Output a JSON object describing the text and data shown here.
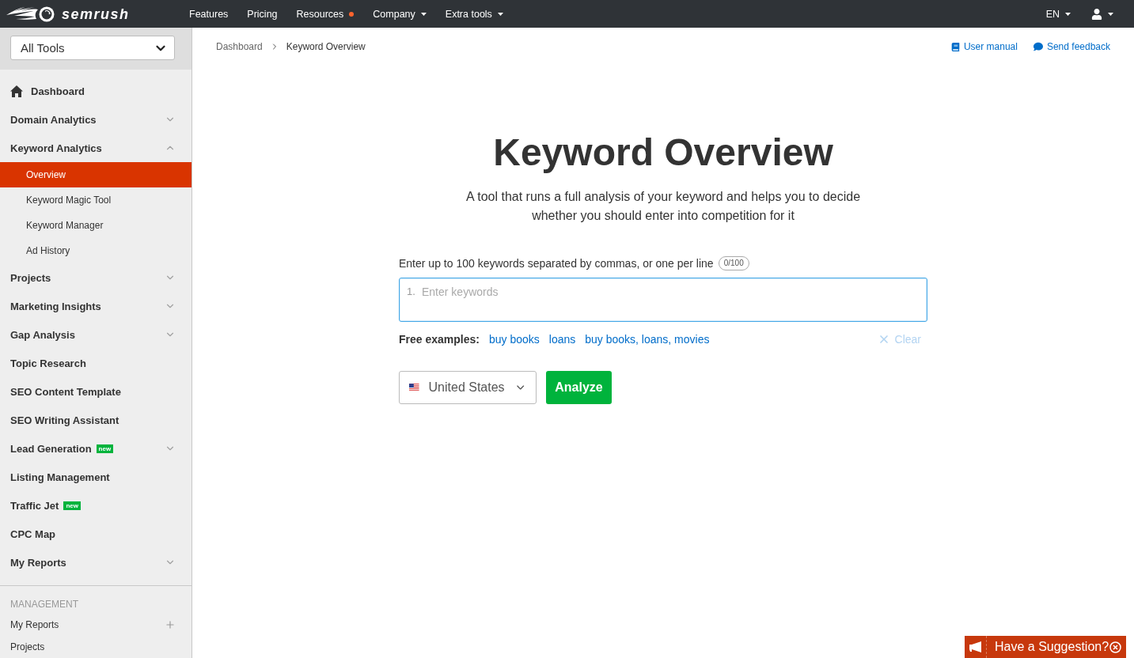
{
  "topbar": {
    "logo": "semrush",
    "nav": [
      {
        "label": "Features",
        "dot": false,
        "caret": false
      },
      {
        "label": "Pricing",
        "dot": false,
        "caret": false
      },
      {
        "label": "Resources",
        "dot": true,
        "caret": false
      },
      {
        "label": "Company",
        "dot": false,
        "caret": true
      },
      {
        "label": "Extra tools",
        "dot": false,
        "caret": true
      }
    ],
    "language": "EN"
  },
  "sidebar": {
    "tool_select": "All Tools",
    "items": [
      {
        "label": "Dashboard",
        "kind": "home"
      },
      {
        "label": "Domain Analytics",
        "kind": "group",
        "expanded": false
      },
      {
        "label": "Keyword Analytics",
        "kind": "group",
        "expanded": true,
        "children": [
          {
            "label": "Overview",
            "selected": true
          },
          {
            "label": "Keyword Magic Tool",
            "selected": false
          },
          {
            "label": "Keyword Manager",
            "selected": false
          },
          {
            "label": "Ad History",
            "selected": false
          }
        ]
      },
      {
        "label": "Projects",
        "kind": "group",
        "expanded": false
      },
      {
        "label": "Marketing Insights",
        "kind": "group",
        "expanded": false
      },
      {
        "label": "Gap Analysis",
        "kind": "group",
        "expanded": false
      },
      {
        "label": "Topic Research",
        "kind": "link"
      },
      {
        "label": "SEO Content Template",
        "kind": "link"
      },
      {
        "label": "SEO Writing Assistant",
        "kind": "link"
      },
      {
        "label": "Lead Generation",
        "kind": "group",
        "expanded": false,
        "badge": "new"
      },
      {
        "label": "Listing Management",
        "kind": "link"
      },
      {
        "label": "Traffic Jet",
        "kind": "link",
        "badge": "new"
      },
      {
        "label": "CPC Map",
        "kind": "link"
      },
      {
        "label": "My Reports",
        "kind": "group",
        "expanded": false
      }
    ],
    "management": {
      "heading": "MANAGEMENT",
      "items": [
        {
          "label": "My Reports",
          "kind": "add"
        },
        {
          "label": "Projects",
          "kind": "plain"
        }
      ]
    }
  },
  "main": {
    "breadcrumb": [
      "Dashboard",
      "Keyword Overview"
    ],
    "help_links": [
      {
        "label": "User manual",
        "kind": "manual"
      },
      {
        "label": "Send feedback",
        "kind": "feedback"
      }
    ],
    "title": "Keyword Overview",
    "description": "A tool that runs a full analysis of your keyword and helps you to decide whether you should enter into competition for it",
    "keywords": {
      "label": "Enter up to 100 keywords separated by commas, or one per line",
      "counter": "0/100",
      "line_number": "1.",
      "placeholder": "Enter keywords"
    },
    "examples": {
      "label": "Free examples:",
      "items": [
        "buy books",
        "loans",
        "buy books, loans, movies"
      ],
      "clear": {
        "label": "Clear",
        "disabled": true
      }
    },
    "database": "United States",
    "analyze_button": "Analyze"
  },
  "suggestion": {
    "label": "Have a Suggestion?"
  }
}
